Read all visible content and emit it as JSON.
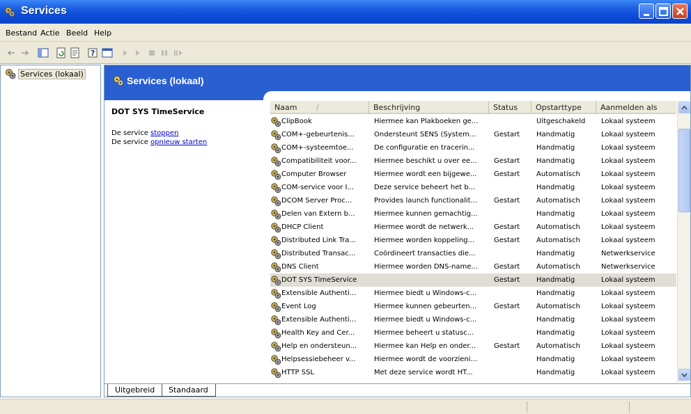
{
  "window": {
    "title": "Services"
  },
  "menu": [
    "Bestand",
    "Actie",
    "Beeld",
    "Help"
  ],
  "tree": {
    "item": "Services (lokaal)"
  },
  "header": {
    "title": "Services (lokaal)"
  },
  "description": {
    "service_name": "DOT SYS TimeService",
    "line1_prefix": "De service ",
    "line1_link": "stoppen",
    "line2_prefix": "De service ",
    "line2_link": "opnieuw starten"
  },
  "columns": [
    "Naam",
    "Beschrijving",
    "Status",
    "Opstarttype",
    "Aanmelden als"
  ],
  "sort_indicator": "/",
  "services": [
    {
      "name": "ClipBook",
      "desc": "Hiermee kan Plakboeken ge...",
      "status": "",
      "startup": "Uitgeschakeld",
      "logon": "Lokaal systeem"
    },
    {
      "name": "COM+-gebeurtenis...",
      "desc": "Ondersteunt SENS (System...",
      "status": "Gestart",
      "startup": "Handmatig",
      "logon": "Lokaal systeem"
    },
    {
      "name": "COM+-systeemtoe...",
      "desc": "De configuratie en tracerin...",
      "status": "",
      "startup": "Handmatig",
      "logon": "Lokaal systeem"
    },
    {
      "name": "Compatibiliteit voor...",
      "desc": "Hiermee beschikt u over ee...",
      "status": "Gestart",
      "startup": "Handmatig",
      "logon": "Lokaal systeem"
    },
    {
      "name": "Computer Browser",
      "desc": "Hiermee wordt een bijgewe...",
      "status": "Gestart",
      "startup": "Automatisch",
      "logon": "Lokaal systeem"
    },
    {
      "name": "COM-service voor I...",
      "desc": "Deze service beheert het b...",
      "status": "",
      "startup": "Handmatig",
      "logon": "Lokaal systeem"
    },
    {
      "name": "DCOM Server Proc...",
      "desc": "Provides launch functionalit...",
      "status": "Gestart",
      "startup": "Automatisch",
      "logon": "Lokaal systeem"
    },
    {
      "name": "Delen van Extern b...",
      "desc": "Hiermee kunnen gemachtig...",
      "status": "",
      "startup": "Handmatig",
      "logon": "Lokaal systeem"
    },
    {
      "name": "DHCP Client",
      "desc": "Hiermee wordt de netwerk...",
      "status": "Gestart",
      "startup": "Automatisch",
      "logon": "Lokaal systeem"
    },
    {
      "name": "Distributed Link Tra...",
      "desc": "Hiermee worden koppeling...",
      "status": "Gestart",
      "startup": "Automatisch",
      "logon": "Lokaal systeem"
    },
    {
      "name": "Distributed Transac...",
      "desc": "Coördineert transacties die...",
      "status": "",
      "startup": "Handmatig",
      "logon": "Netwerkservice"
    },
    {
      "name": "DNS Client",
      "desc": "Hiermee worden DNS-name...",
      "status": "Gestart",
      "startup": "Automatisch",
      "logon": "Netwerkservice"
    },
    {
      "name": "DOT SYS TimeService",
      "desc": "",
      "status": "Gestart",
      "startup": "Handmatig",
      "logon": "Lokaal systeem"
    },
    {
      "name": "Extensible Authenti...",
      "desc": "Hiermee biedt u Windows-c...",
      "status": "",
      "startup": "Handmatig",
      "logon": "Lokaal systeem"
    },
    {
      "name": "Event Log",
      "desc": "Hiermee kunnen gebeurten...",
      "status": "Gestart",
      "startup": "Automatisch",
      "logon": "Lokaal systeem"
    },
    {
      "name": "Extensible Authenti...",
      "desc": "Hiermee biedt u Windows-c...",
      "status": "",
      "startup": "Handmatig",
      "logon": "Lokaal systeem"
    },
    {
      "name": "Health Key and Cer...",
      "desc": "Hiermee beheert u statusc...",
      "status": "",
      "startup": "Handmatig",
      "logon": "Lokaal systeem"
    },
    {
      "name": "Help en ondersteun...",
      "desc": "Hiermee kan Help en onder...",
      "status": "Gestart",
      "startup": "Automatisch",
      "logon": "Lokaal systeem"
    },
    {
      "name": "Helpsessiebeheer v...",
      "desc": "Hiermee wordt de voorzieni...",
      "status": "",
      "startup": "Handmatig",
      "logon": "Lokaal systeem"
    },
    {
      "name": "HTTP SSL",
      "desc": "Met deze service wordt HT...",
      "status": "",
      "startup": "Handmatig",
      "logon": "Lokaal systeem"
    }
  ],
  "selected_service": "DOT SYS TimeService",
  "tabs": [
    "Uitgebreid",
    "Standaard"
  ],
  "colors": {
    "title_bar": "#0b4ad6",
    "header_band": "#2a5fd1",
    "selected_row": "#e0ddd6",
    "chrome": "#ece9d8"
  }
}
